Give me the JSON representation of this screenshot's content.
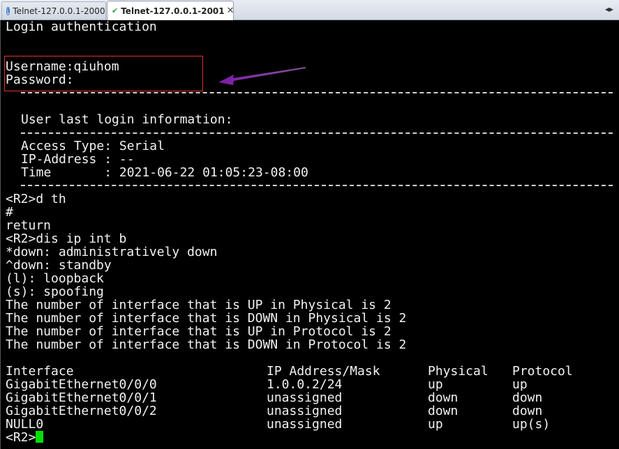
{
  "tabs": [
    {
      "label": "Telnet-127.0.0.1-2000",
      "active": false,
      "icon": "info-icon"
    },
    {
      "label": "Telnet-127.0.0.1-2001",
      "active": true,
      "icon": "check-icon"
    }
  ],
  "terminal": {
    "login_auth": "Login authentication",
    "username_line": "Username:qiuhom",
    "password_line": "Password:",
    "last_login_title": "User last login information:",
    "access_type": "Access Type: Serial",
    "ip_address": "IP-Address : --",
    "time": "Time       : 2021-06-22 01:05:23-08:00",
    "cmd1": "<R2>d th",
    "hash": "#",
    "return": "return",
    "cmd2": "<R2>dis ip int b",
    "legend": [
      "*down: administratively down",
      "^down: standby",
      "(l): loopback",
      "(s): spoofing"
    ],
    "summary": [
      "The number of interface that is UP in Physical is 2",
      "The number of interface that is DOWN in Physical is 2",
      "The number of interface that is UP in Protocol is 2",
      "The number of interface that is DOWN in Protocol is 2"
    ],
    "table_headers": [
      "Interface",
      "IP Address/Mask",
      "Physical",
      "Protocol"
    ],
    "table_rows": [
      [
        "GigabitEthernet0/0/0",
        "1.0.0.2/24",
        "up",
        "up"
      ],
      [
        "GigabitEthernet0/0/1",
        "unassigned",
        "down",
        "down"
      ],
      [
        "GigabitEthernet0/0/2",
        "unassigned",
        "down",
        "down"
      ],
      [
        "NULL0",
        "unassigned",
        "up",
        "up(s)"
      ]
    ],
    "prompt": "<R2>"
  },
  "colors": {
    "background": "#000000",
    "text": "#f2f2f2",
    "cursor": "#00e000",
    "highlight_box": "#e03030",
    "arrow": "#7a1aa8"
  }
}
